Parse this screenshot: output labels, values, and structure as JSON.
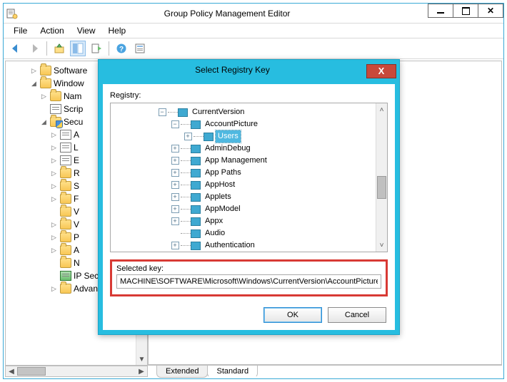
{
  "main": {
    "title": "Group Policy Management Editor",
    "menu": {
      "file": "File",
      "action": "Action",
      "view": "View",
      "help": "Help"
    },
    "tree": [
      {
        "indent": 2,
        "exp": "▷",
        "icon": "folder",
        "label": "Software"
      },
      {
        "indent": 2,
        "exp": "◢",
        "icon": "folder",
        "label": "Window"
      },
      {
        "indent": 3,
        "exp": "▷",
        "icon": "folder",
        "label": "Nam"
      },
      {
        "indent": 3,
        "exp": "",
        "icon": "doc",
        "label": "Scrip"
      },
      {
        "indent": 3,
        "exp": "◢",
        "icon": "folder-shield",
        "label": "Secu"
      },
      {
        "indent": 4,
        "exp": "▷",
        "icon": "doc",
        "label": "A"
      },
      {
        "indent": 4,
        "exp": "▷",
        "icon": "doc",
        "label": "L"
      },
      {
        "indent": 4,
        "exp": "▷",
        "icon": "doc",
        "label": "E"
      },
      {
        "indent": 4,
        "exp": "▷",
        "icon": "folder",
        "label": "R"
      },
      {
        "indent": 4,
        "exp": "▷",
        "icon": "folder",
        "label": "S"
      },
      {
        "indent": 4,
        "exp": "▷",
        "icon": "folder",
        "label": "F"
      },
      {
        "indent": 4,
        "exp": "",
        "icon": "folder",
        "label": "V"
      },
      {
        "indent": 4,
        "exp": "▷",
        "icon": "folder",
        "label": "V"
      },
      {
        "indent": 4,
        "exp": "▷",
        "icon": "folder",
        "label": "P"
      },
      {
        "indent": 4,
        "exp": "▷",
        "icon": "folder",
        "label": "A"
      },
      {
        "indent": 4,
        "exp": "",
        "icon": "folder",
        "label": "N"
      },
      {
        "indent": 4,
        "exp": "",
        "icon": "ip",
        "label": "IP Security"
      },
      {
        "indent": 4,
        "exp": "▷",
        "icon": "folder",
        "label": "Advanced"
      }
    ],
    "tabs": {
      "extended": "Extended",
      "standard": "Standard"
    }
  },
  "dialog": {
    "title": "Select Registry Key",
    "close": "X",
    "registry_label": "Registry:",
    "tree": [
      {
        "depth": 0,
        "box": "−",
        "label": "CurrentVersion",
        "sel": false
      },
      {
        "depth": 1,
        "box": "−",
        "label": "AccountPicture",
        "sel": false
      },
      {
        "depth": 2,
        "box": "+",
        "label": "Users",
        "sel": true
      },
      {
        "depth": 1,
        "box": "+",
        "label": "AdminDebug",
        "sel": false
      },
      {
        "depth": 1,
        "box": "+",
        "label": "App Management",
        "sel": false
      },
      {
        "depth": 1,
        "box": "+",
        "label": "App Paths",
        "sel": false
      },
      {
        "depth": 1,
        "box": "+",
        "label": "AppHost",
        "sel": false
      },
      {
        "depth": 1,
        "box": "+",
        "label": "Applets",
        "sel": false
      },
      {
        "depth": 1,
        "box": "+",
        "label": "AppModel",
        "sel": false
      },
      {
        "depth": 1,
        "box": "+",
        "label": "Appx",
        "sel": false
      },
      {
        "depth": 1,
        "box": "",
        "label": "Audio",
        "sel": false
      },
      {
        "depth": 1,
        "box": "+",
        "label": "Authentication",
        "sel": false
      }
    ],
    "selected_label": "Selected key:",
    "selected_value": "MACHINE\\SOFTWARE\\Microsoft\\Windows\\CurrentVersion\\AccountPicture\\Users",
    "ok": "OK",
    "cancel": "Cancel"
  }
}
